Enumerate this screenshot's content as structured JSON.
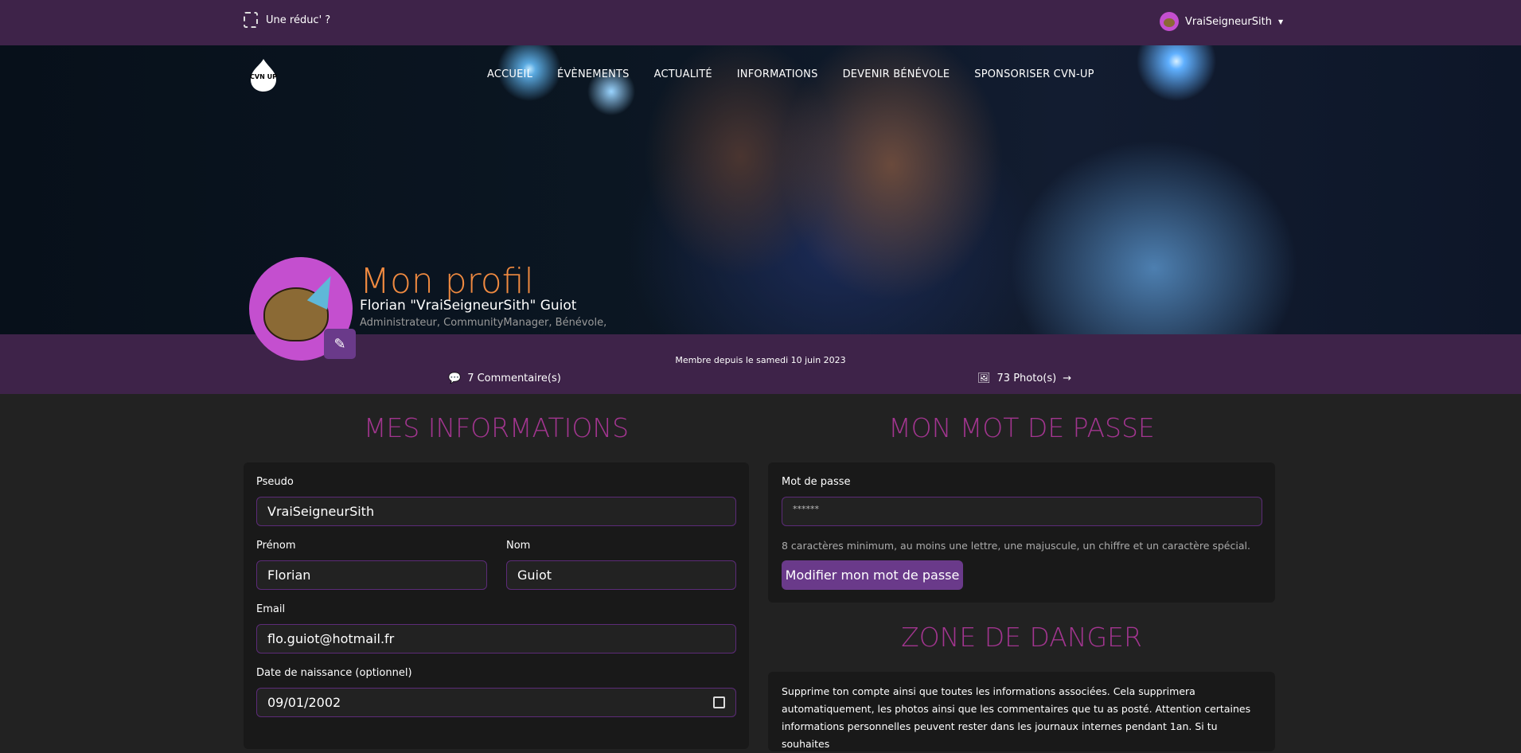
{
  "topbar": {
    "promo": "Une réduc' ?",
    "username": "VraiSeigneurSith"
  },
  "nav": {
    "items": [
      "ACCUEIL",
      "ÉVÈNEMENTS",
      "ACTUALITÉ",
      "INFORMATIONS",
      "DEVENIR BÉNÉVOLE",
      "SPONSORISER CVN-UP"
    ],
    "logo": "CVN UP"
  },
  "profile": {
    "title": "Mon profil",
    "name": "Florian \"VraiSeigneurSith\" Guiot",
    "roles": "Administrateur, CommunityManager, Bénévole,",
    "member_since": "Membre depuis le samedi 10 juin 2023",
    "comments": "7 Commentaire(s)",
    "photos": "73 Photo(s)"
  },
  "info": {
    "heading": "MES INFORMATIONS",
    "pseudo_label": "Pseudo",
    "pseudo": "VraiSeigneurSith",
    "prenom_label": "Prénom",
    "prenom": "Florian",
    "nom_label": "Nom",
    "nom": "Guiot",
    "email_label": "Email",
    "email": "flo.guiot@hotmail.fr",
    "dob_label": "Date de naissance (optionnel)",
    "dob": "09/01/2002"
  },
  "password": {
    "heading": "MON MOT DE PASSE",
    "label": "Mot de passe",
    "value": "******",
    "help": "8 caractères minimum, au moins une lettre, une majuscule, un chiffre et un caractère spécial.",
    "button": "Modifier mon mot de passe"
  },
  "danger": {
    "heading": "ZONE DE DANGER",
    "text": "Supprime ton compte ainsi que toutes les informations associées. Cela supprimera automatiquement, les photos ainsi que les commentaires que tu as posté. Attention certaines informations personnelles peuvent rester dans les journaux internes pendant 1an. Si tu souhaites"
  },
  "colors": {
    "brand_purple": "#3e2349",
    "accent": "#a2358f",
    "title_orange": "#f08a40",
    "button": "#6a3a8a"
  }
}
